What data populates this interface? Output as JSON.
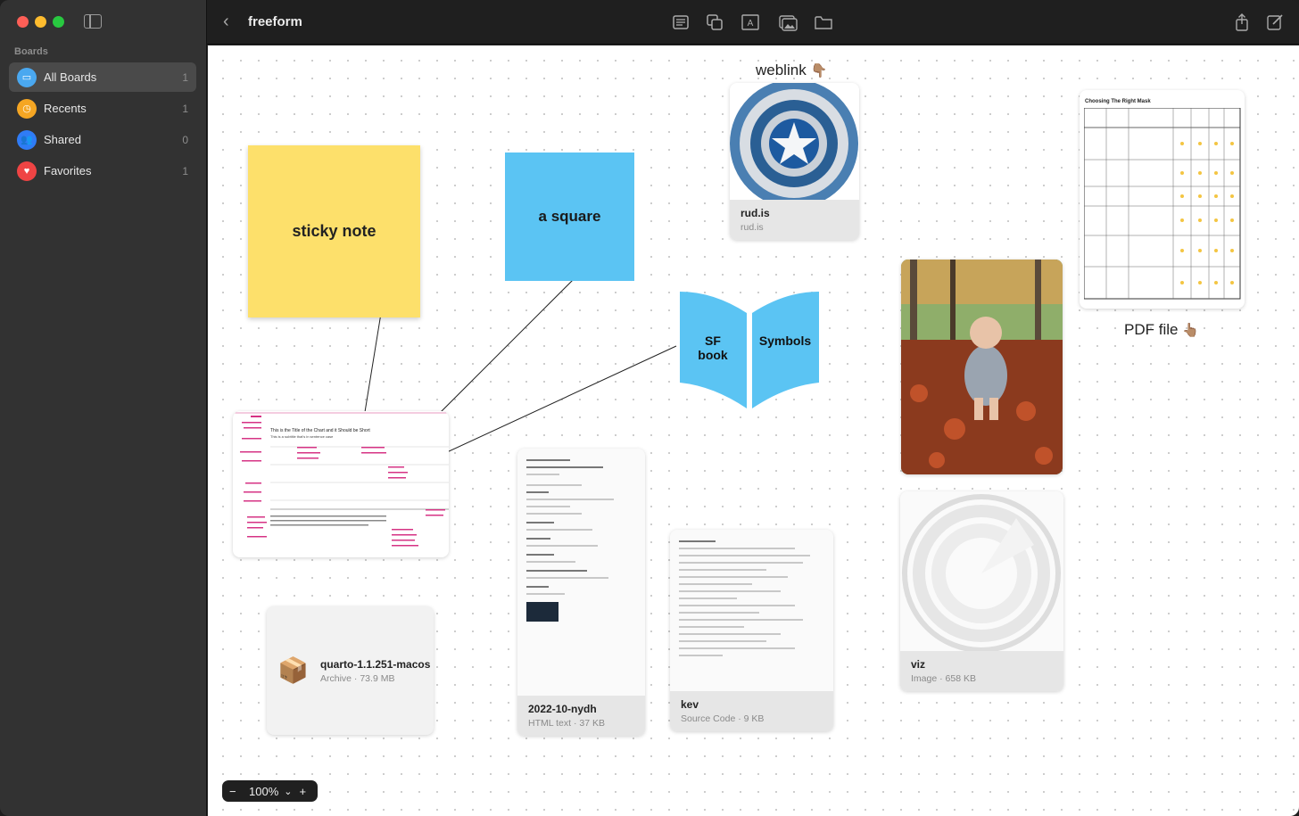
{
  "sidebar": {
    "heading": "Boards",
    "items": [
      {
        "label": "All Boards",
        "count": "1",
        "icon": "all-boards-icon",
        "color": "#4aa8f0"
      },
      {
        "label": "Recents",
        "count": "1",
        "icon": "clock-icon",
        "color": "#f5a623"
      },
      {
        "label": "Shared",
        "count": "0",
        "icon": "people-icon",
        "color": "#2f7cf6"
      },
      {
        "label": "Favorites",
        "count": "1",
        "icon": "heart-icon",
        "color": "#ef4444"
      }
    ]
  },
  "toolbar": {
    "title": "freeform",
    "tools": [
      "text-box-icon",
      "shapes-icon",
      "text-icon",
      "media-icon",
      "folder-icon"
    ],
    "right_tools": [
      "share-icon",
      "compose-icon"
    ]
  },
  "canvas": {
    "sticky_note": "sticky note",
    "square": "a square",
    "book": {
      "left": "SF book",
      "right": "Symbols",
      "color": "#5bc4f3"
    },
    "weblink_label": "weblink",
    "weblink_card": {
      "title": "rud.is",
      "subtitle": "rud.is"
    },
    "pdf_label": "PDF file",
    "pdf_title": "Choosing The Right Mask",
    "chart_doc_title": "This is the Title of the Chart and it Should be Short",
    "chart_doc_subtitle": "This is a subtitle that's in sentence case",
    "html_card": {
      "title": "2022-10-nydh",
      "subtitle": "HTML text · 37 KB"
    },
    "archive_card": {
      "title": "quarto-1.1.251-macos",
      "subtitle": "Archive · 73.9 MB"
    },
    "source_card": {
      "title": "kev",
      "subtitle": "Source Code · 9 KB"
    },
    "image_card": {
      "title": "viz",
      "subtitle": "Image · 658 KB"
    }
  },
  "zoom": {
    "level": "100%",
    "minus": "−",
    "plus": "+",
    "chevron": "⌄"
  }
}
